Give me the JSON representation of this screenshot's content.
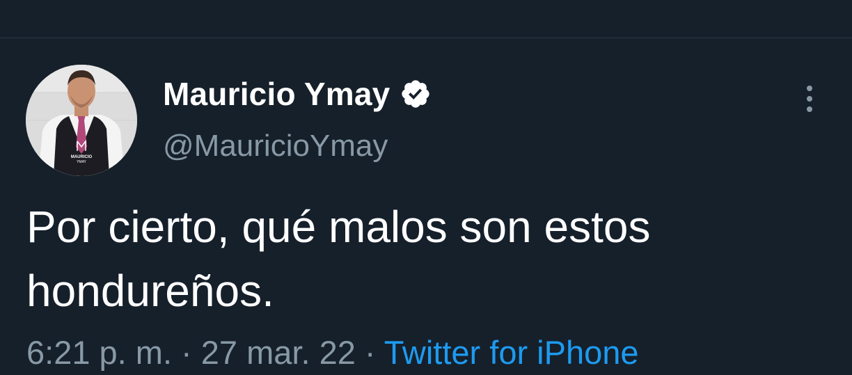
{
  "tweet": {
    "author": {
      "display_name": "Mauricio Ymay",
      "handle": "@MauricioYmay",
      "verified_icon": "verified-badge-icon",
      "avatar_logo_text": "MAURICIO",
      "avatar_logo_subtext": "YMAY"
    },
    "text": "Por cierto, qué malos son estos hondureños.",
    "meta": {
      "time": "6:21 p. m.",
      "separator": " · ",
      "date": "27 mar. 22",
      "source": "Twitter for iPhone"
    },
    "more_icon": "more-vertical-icon"
  },
  "colors": {
    "background": "#16202b",
    "divider": "#2a3744",
    "text_primary": "#ffffff",
    "text_secondary": "#8899a6",
    "link": "#1d9bf0"
  }
}
